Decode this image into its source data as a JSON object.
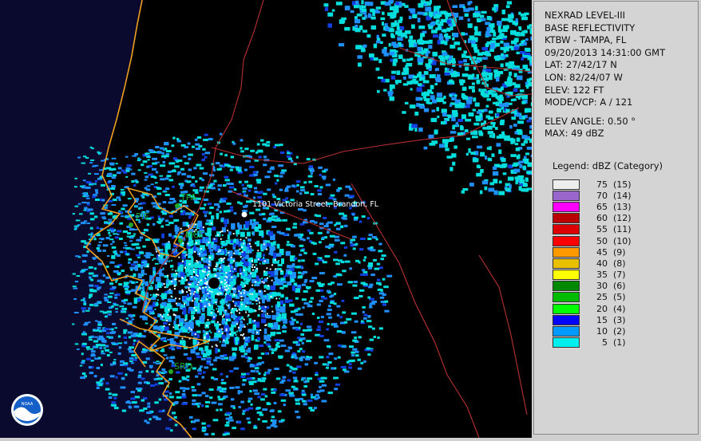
{
  "radar": {
    "product": "NEXRAD LEVEL-III",
    "type": "BASE REFLECTIVITY",
    "station": "KTBW - TAMPA, FL",
    "datetime": "09/20/2013 14:31:00 GMT",
    "lat": "LAT: 27/42/17 N",
    "lon": "LON: 82/24/07 W",
    "elev": "ELEV: 122 FT",
    "mode": "MODE/VCP: A / 121",
    "elev_angle": "ELEV ANGLE: 0.50 °",
    "max": "MAX: 49 dBZ"
  },
  "legend": {
    "title": "Legend: dBZ (Category)",
    "items": [
      {
        "value": "75",
        "category": "(15)",
        "color": "#eeeeee"
      },
      {
        "value": "70",
        "category": "(14)",
        "color": "#9966cc"
      },
      {
        "value": "65",
        "category": "(13)",
        "color": "#ff00ff"
      },
      {
        "value": "60",
        "category": "(12)",
        "color": "#bb0000"
      },
      {
        "value": "55",
        "category": "(11)",
        "color": "#dd0000"
      },
      {
        "value": "50",
        "category": "(10)",
        "color": "#ff0000"
      },
      {
        "value": "45",
        "category": "(9)",
        "color": "#ff9900"
      },
      {
        "value": "40",
        "category": "(8)",
        "color": "#e8c000"
      },
      {
        "value": "35",
        "category": "(7)",
        "color": "#ffff00"
      },
      {
        "value": "30",
        "category": "(6)",
        "color": "#008800"
      },
      {
        "value": "25",
        "category": "(5)",
        "color": "#00bb00"
      },
      {
        "value": "20",
        "category": "(4)",
        "color": "#00ff00"
      },
      {
        "value": "15",
        "category": "(3)",
        "color": "#0000ff"
      },
      {
        "value": "10",
        "category": "(2)",
        "color": "#0099ff"
      },
      {
        "value": "5",
        "category": "(1)",
        "color": "#00eeee"
      }
    ]
  },
  "map": {
    "cities": [
      "TPA",
      "PIE",
      "MCF",
      "SRQ"
    ],
    "address": "1101 Victoria Street, Brandon, FL",
    "logo_text": "NOAA",
    "colors": {
      "gulf": "#0a0a2e",
      "coast": "#f0a020",
      "boundary": "#b83030",
      "echo_light": "#00dddd",
      "echo_mid": "#1e90ff",
      "echo_dark": "#1040e0"
    }
  }
}
